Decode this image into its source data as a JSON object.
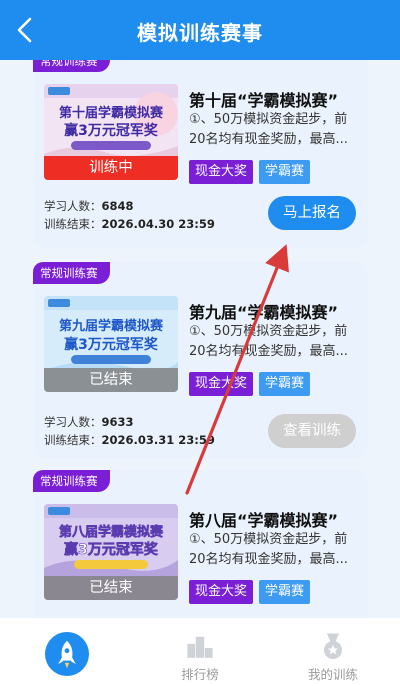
{
  "header": {
    "title": "模拟训练赛事"
  },
  "competitions": [
    {
      "tag": "常规训练赛",
      "poster_title_line1": "第十届学霸模拟赛",
      "poster_title_line2": "赢3万元冠军奖",
      "status": "训练中",
      "title": "第十届“学霸模拟赛”",
      "desc": "①、50万模拟资金起步，前20名均有现金奖励，最高...",
      "chips": [
        "现金大奖",
        "学霸赛"
      ],
      "participants_label": "学习人数：",
      "participants": "6848",
      "end_label": "训练结束：",
      "end_time": "2026.04.30 23:59",
      "button": "马上报名"
    },
    {
      "tag": "常规训练赛",
      "poster_title_line1": "第九届学霸模拟赛",
      "poster_title_line2": "赢3万元冠军奖",
      "status": "已结束",
      "title": "第九届“学霸模拟赛”",
      "desc": "①、50万模拟资金起步，前20名均有现金奖励，最高...",
      "chips": [
        "现金大奖",
        "学霸赛"
      ],
      "participants_label": "学习人数：",
      "participants": "9633",
      "end_label": "训练结束：",
      "end_time": "2026.03.31 23:59",
      "button": "查看训练"
    },
    {
      "tag": "常规训练赛",
      "poster_title_line1": "第八届学霸模拟赛",
      "poster_title_line2": "赢3万元冠军奖",
      "status": "已结束",
      "title": "第八届“学霸模拟赛”",
      "desc": "①、50万模拟资金起步，前20名均有现金奖励，最高...",
      "chips": [
        "现金大奖",
        "学霸赛"
      ]
    }
  ],
  "tabbar": {
    "items": [
      {
        "label": "",
        "icon": "rocket-icon",
        "active": true
      },
      {
        "label": "排行榜",
        "icon": "podium-icon",
        "active": false
      },
      {
        "label": "我的训练",
        "icon": "medal-icon",
        "active": false
      }
    ]
  },
  "colors": {
    "primary": "#1f8cf0",
    "tag_purple": "#7a1fd6",
    "status_red": "#ee2e24",
    "annotation_arrow": "#d93a3a"
  }
}
